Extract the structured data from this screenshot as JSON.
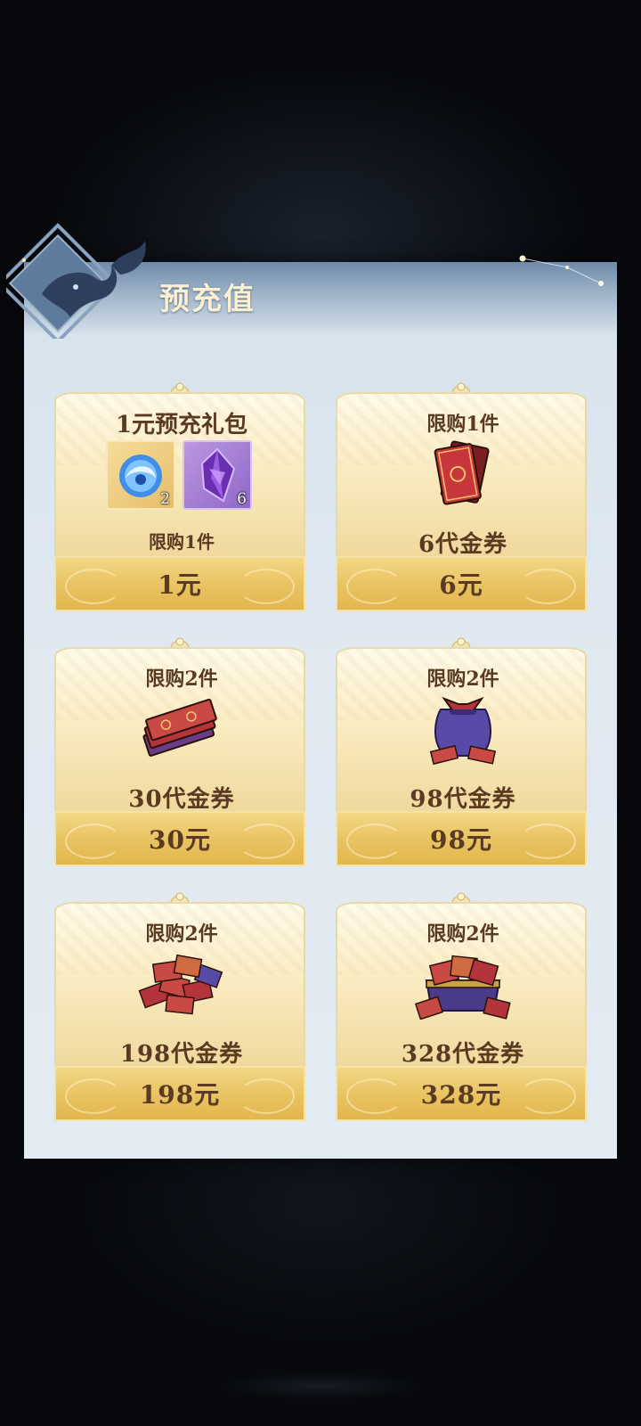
{
  "panel": {
    "title": "预充值"
  },
  "cards": [
    {
      "type": "gift",
      "title": "1元预充礼包",
      "slots": [
        {
          "icon": "blue-orb-icon",
          "count": "2"
        },
        {
          "icon": "purple-crystal-icon",
          "count": "6"
        }
      ],
      "limit": "限购1件",
      "price": "1元"
    },
    {
      "type": "voucher",
      "limit": "限购1件",
      "icon": "voucher-cards-icon",
      "name": "6代金券",
      "price": "6元"
    },
    {
      "type": "voucher",
      "limit": "限购2件",
      "icon": "voucher-stack-icon",
      "name": "30代金券",
      "price": "30元"
    },
    {
      "type": "voucher",
      "limit": "限购2件",
      "icon": "voucher-pouch-icon",
      "name": "98代金券",
      "price": "98元"
    },
    {
      "type": "voucher",
      "limit": "限购2件",
      "icon": "voucher-pile-icon",
      "name": "198代金券",
      "price": "198元"
    },
    {
      "type": "voucher",
      "limit": "限购2件",
      "icon": "voucher-chest-icon",
      "name": "328代金券",
      "price": "328元"
    }
  ],
  "colors": {
    "text_brown": "#5a3a20",
    "price_gold": "#e9c463",
    "panel_blue": "#d6e2ec"
  }
}
